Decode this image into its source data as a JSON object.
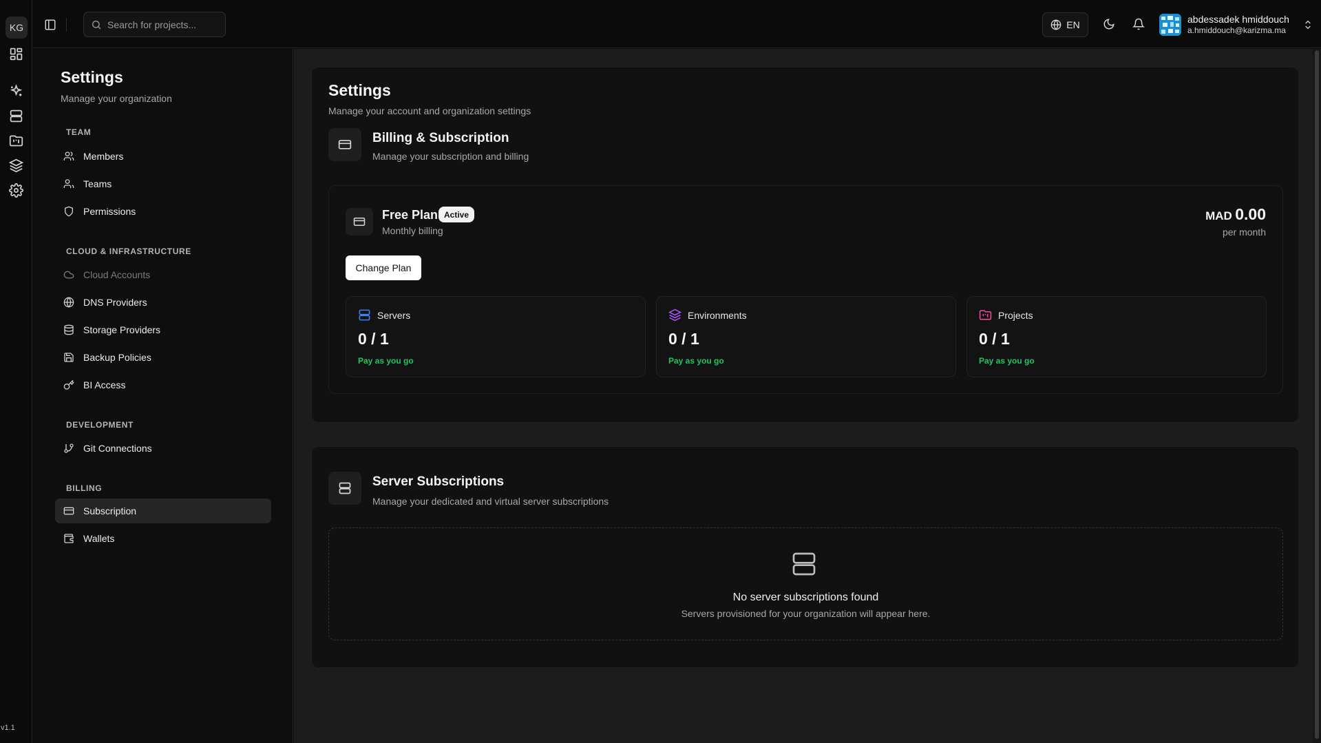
{
  "rail": {
    "org_initials": "KG",
    "version": "v1.1"
  },
  "topbar": {
    "search_placeholder": "Search for projects...",
    "language": "EN",
    "user": {
      "name": "abdessadek hmiddouch",
      "email": "a.hmiddouch@karizma.ma"
    }
  },
  "settings_nav": {
    "title": "Settings",
    "subtitle": "Manage your organization",
    "sections": {
      "team": "TEAM",
      "cloud": "CLOUD & INFRASTRUCTURE",
      "development": "DEVELOPMENT",
      "billing": "BILLING"
    },
    "items": {
      "members": "Members",
      "teams": "Teams",
      "permissions": "Permissions",
      "cloud_accounts": "Cloud Accounts",
      "dns_providers": "DNS Providers",
      "storage_providers": "Storage Providers",
      "backup_policies": "Backup Policies",
      "bi_access": "BI Access",
      "git_connections": "Git Connections",
      "subscription": "Subscription",
      "wallets": "Wallets"
    },
    "active_item": "subscription"
  },
  "main": {
    "title": "Settings",
    "subtitle": "Manage your account and organization settings",
    "billing": {
      "title": "Billing & Subscription",
      "subtitle": "Manage your subscription and billing",
      "plan": {
        "name": "Free Plan",
        "badge": "Active",
        "billing_cycle": "Monthly billing",
        "currency": "MAD",
        "amount": "0.00",
        "period": "per month",
        "change_label": "Change Plan"
      },
      "usage": [
        {
          "label": "Servers",
          "count": "0 / 1",
          "note": "Pay as you go",
          "icon": "server-icon",
          "color": "#3b82f6"
        },
        {
          "label": "Environments",
          "count": "0 / 1",
          "note": "Pay as you go",
          "icon": "layers-icon",
          "color": "#a855f7"
        },
        {
          "label": "Projects",
          "count": "0 / 1",
          "note": "Pay as you go",
          "icon": "folder-kanban-icon",
          "color": "#ec4899"
        }
      ]
    },
    "server_subscriptions": {
      "title": "Server Subscriptions",
      "subtitle": "Manage your dedicated and virtual server subscriptions",
      "empty_title": "No server subscriptions found",
      "empty_subtitle": "Servers provisioned for your organization will appear here."
    }
  },
  "colors": {
    "accent_green": "#22c55e",
    "background": "#0b0b0b",
    "panel": "#111111"
  }
}
